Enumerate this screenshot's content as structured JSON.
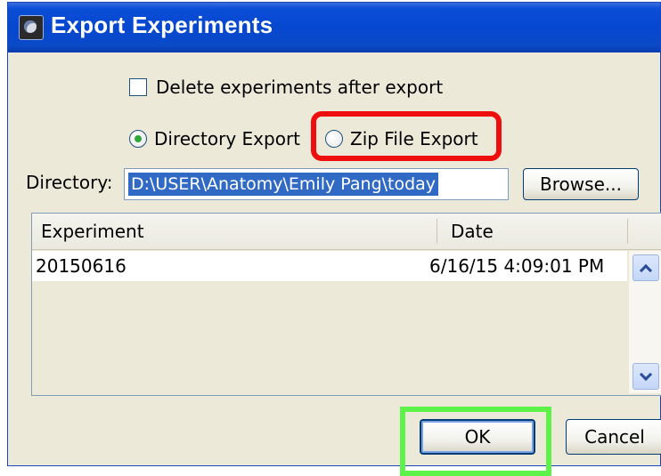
{
  "window": {
    "title": "Export Experiments",
    "icon": "app-icon"
  },
  "options": {
    "delete_after_export_label": "Delete experiments after export",
    "delete_after_export_checked": false,
    "directory_export_label": "Directory Export",
    "directory_export_selected": true,
    "zip_export_label": "Zip File Export",
    "zip_export_selected": false
  },
  "directory": {
    "label": "Directory:",
    "value": "D:\\USER\\Anatomy\\Emily Pang\\today",
    "browse_label": "Browse..."
  },
  "table": {
    "columns": [
      "Experiment",
      "Date"
    ],
    "rows": [
      {
        "experiment": "20150616",
        "date": "6/16/15 4:09:01 PM"
      }
    ]
  },
  "buttons": {
    "ok_label": "OK",
    "cancel_label": "Cancel"
  },
  "highlights": {
    "zip_color": "#ee0e0e",
    "ok_color": "#5cf24a"
  }
}
